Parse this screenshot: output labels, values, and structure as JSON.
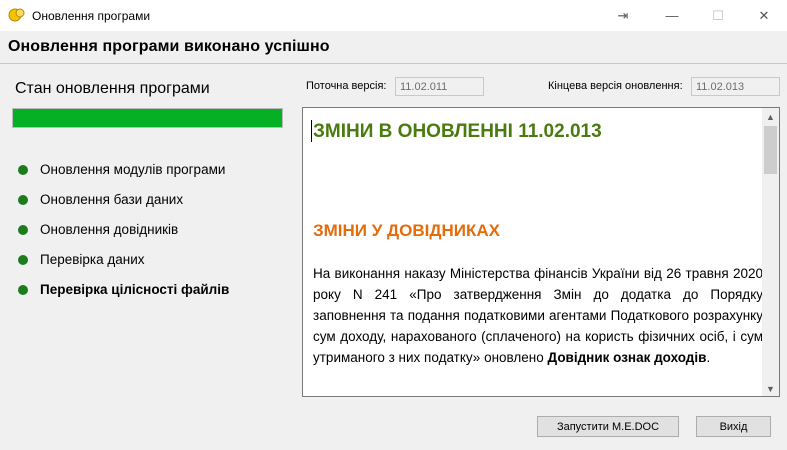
{
  "window": {
    "title": "Оновлення програми",
    "buttons": {
      "restore": "⇥",
      "minimize": "—",
      "maximize": "☐",
      "close": "✕"
    }
  },
  "header": {
    "text": "Оновлення програми виконано успішно"
  },
  "status": {
    "title": "Стан оновлення програми",
    "progress": 1.0,
    "steps": [
      {
        "label": "Оновлення модулів програми"
      },
      {
        "label": "Оновлення бази даних"
      },
      {
        "label": "Оновлення довідників"
      },
      {
        "label": "Перевірка даних"
      },
      {
        "label": "Перевірка цілісності файлів"
      }
    ]
  },
  "versions": {
    "current_label": "Поточна версія:",
    "current_value": "11.02.011",
    "final_label": "Кінцева версія оновлення:",
    "final_value": "11.02.013"
  },
  "document": {
    "title": "ЗМІНИ В ОНОВЛЕННІ 11.02.013",
    "section": "ЗМІНИ У ДОВІДНИКАХ",
    "paragraph_text": "На виконання наказу Міністерства фінансів України від 26 травня 2020 року N 241 «Про затвердження Змін до додатка до Порядку заповнення та подання податковими агентами Податкового розрахунку сум доходу, нарахованого (сплаченого) на користь фізичних осіб, і сум утриманого з них податку» оновлено",
    "paragraph_bold": "Довідник ознак доходів",
    "paragraph_end": "."
  },
  "buttons": {
    "launch": "Запустити M.E.DOC",
    "exit": "Вихід"
  },
  "colors": {
    "progress": "#06b025",
    "step_dot": "#1c7c1c",
    "doc_title": "#4a7b0e",
    "doc_section": "#e46c0a"
  }
}
